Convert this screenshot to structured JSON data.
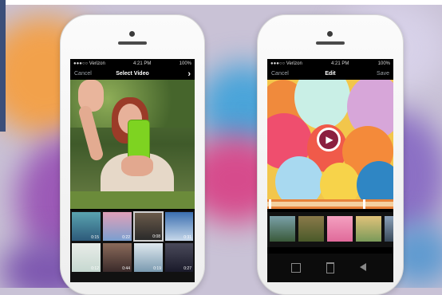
{
  "left_phone": {
    "status": {
      "carrier": "●●●○○ Verizon",
      "time": "4:21 PM",
      "battery": "100%"
    },
    "nav": {
      "cancel_label": "Cancel",
      "title": "Select Video",
      "next_glyph": "›"
    },
    "grid_durations": [
      "0:15",
      "0:22",
      "0:08",
      "0:31",
      "0:12",
      "0:44",
      "0:19",
      "0:27"
    ]
  },
  "right_phone": {
    "status": {
      "carrier": "●●●○○ Verizon",
      "time": "4:21 PM",
      "battery": "100%"
    },
    "nav": {
      "cancel_label": "Cancel",
      "title": "Edit",
      "save_label": "Save"
    },
    "play_glyph": "▶",
    "toolbar_icons": [
      "crop-icon",
      "trash-icon",
      "mute-icon"
    ]
  },
  "colors": {
    "screen_bg": "#000000",
    "phone_body": "#f6f6f6",
    "accent_play": "#8b1f3f"
  }
}
